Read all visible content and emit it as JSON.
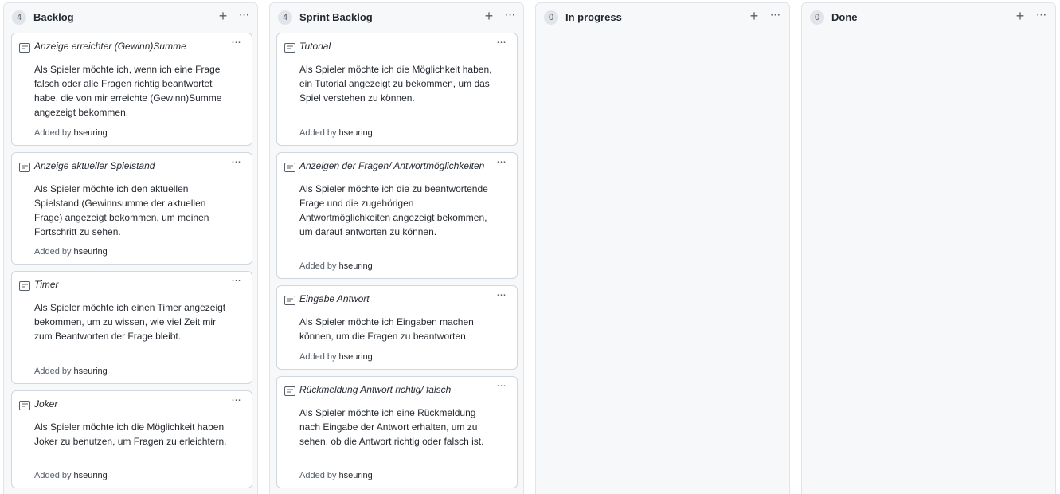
{
  "columns": [
    {
      "count": "4",
      "title": "Backlog",
      "cards": [
        {
          "title": "Anzeige erreichter (Gewinn)Summe",
          "body": "Als Spieler möchte ich, wenn ich eine Frage falsch oder alle Fragen richtig beantwortet habe, die von mir erreichte (Gewinn)Summe angezeigt bekommen.",
          "added_by_label": "Added by",
          "user": "hseuring"
        },
        {
          "title": "Anzeige aktueller Spielstand",
          "body": "Als Spieler möchte ich den aktuellen Spielstand (Gewinnsumme der aktuellen Frage) angezeigt bekommen, um meinen Fortschritt zu sehen.",
          "added_by_label": "Added by",
          "user": "hseuring"
        },
        {
          "title": "Timer",
          "body": "Als Spieler möchte ich einen Timer angezeigt bekommen, um zu wissen, wie viel Zeit mir zum Beantworten der Frage bleibt.",
          "added_by_label": "Added by",
          "user": "hseuring"
        },
        {
          "title": "Joker",
          "body": "Als Spieler möchte ich die Möglichkeit haben Joker zu benutzen, um Fragen zu erleichtern.",
          "added_by_label": "Added by",
          "user": "hseuring"
        }
      ]
    },
    {
      "count": "4",
      "title": "Sprint Backlog",
      "cards": [
        {
          "title": "Tutorial",
          "body": "Als Spieler möchte ich die Möglichkeit haben, ein Tutorial angezeigt zu bekommen, um das Spiel verstehen zu können.",
          "added_by_label": "Added by",
          "user": "hseuring"
        },
        {
          "title": "Anzeigen der Fragen/ Antwortmöglichkeiten",
          "body": "Als Spieler möchte ich die zu beantwortende Frage und die zugehörigen Antwortmöglichkeiten angezeigt bekommen, um darauf antworten zu können.",
          "added_by_label": "Added by",
          "user": "hseuring"
        },
        {
          "title": "Eingabe Antwort",
          "body": "Als Spieler möchte ich Eingaben machen können, um die Fragen zu beantworten.",
          "added_by_label": "Added by",
          "user": "hseuring"
        },
        {
          "title": "Rückmeldung Antwort richtig/ falsch",
          "body": "Als Spieler möchte ich eine Rückmeldung nach Eingabe der Antwort erhalten, um zu sehen, ob die Antwort richtig oder falsch ist.",
          "added_by_label": "Added by",
          "user": "hseuring"
        }
      ]
    },
    {
      "count": "0",
      "title": "In progress",
      "cards": []
    },
    {
      "count": "0",
      "title": "Done",
      "cards": []
    }
  ],
  "icons": {
    "add": "plus-icon",
    "more": "kebab-horizontal-icon",
    "note": "note-icon"
  },
  "glyphs": {
    "add": "+",
    "more": "···"
  }
}
